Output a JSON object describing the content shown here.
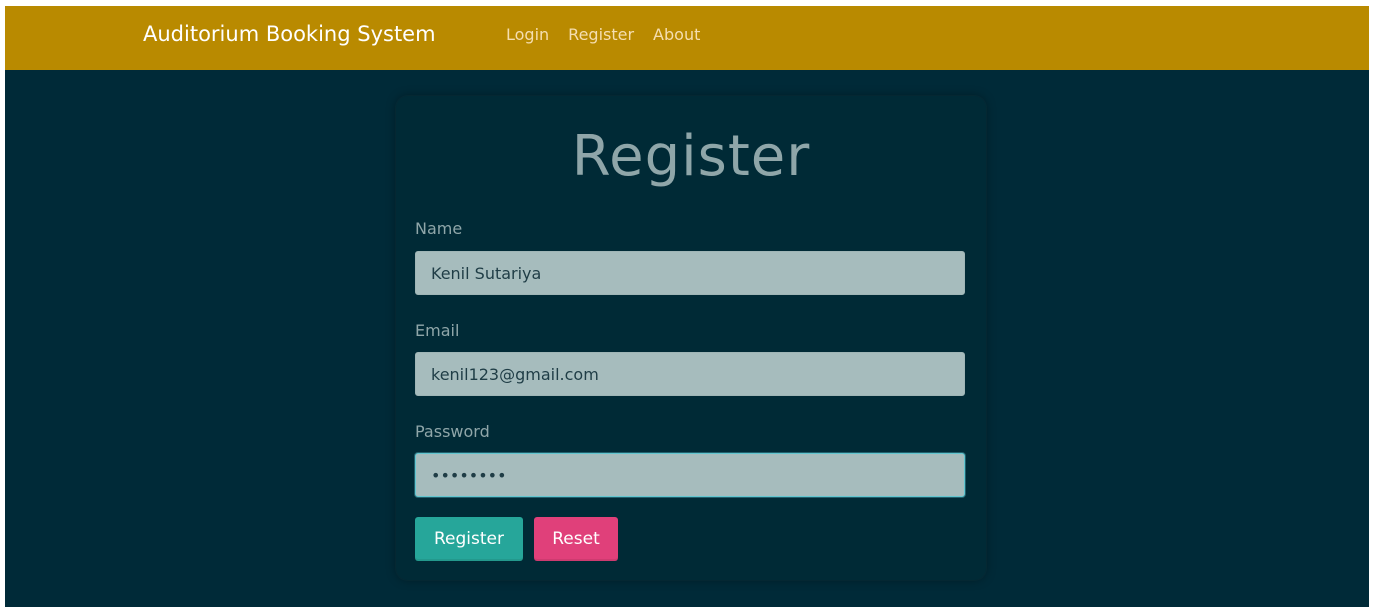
{
  "navbar": {
    "brand": "Auditorium Booking System",
    "links": [
      "Login",
      "Register",
      "About"
    ],
    "background_color": "#b98a00"
  },
  "form": {
    "title": "Register",
    "fields": [
      {
        "label": "Name",
        "value": "Kenil Sutariya",
        "type": "text"
      },
      {
        "label": "Email",
        "value": "kenil123@gmail.com",
        "type": "email"
      },
      {
        "label": "Password",
        "value": "••••••••",
        "type": "password"
      }
    ],
    "buttons": {
      "register": "Register",
      "reset": "Reset"
    },
    "colors": {
      "page_background": "#002a38",
      "register_button": "#26a69a",
      "reset_button": "#e0407a"
    }
  }
}
